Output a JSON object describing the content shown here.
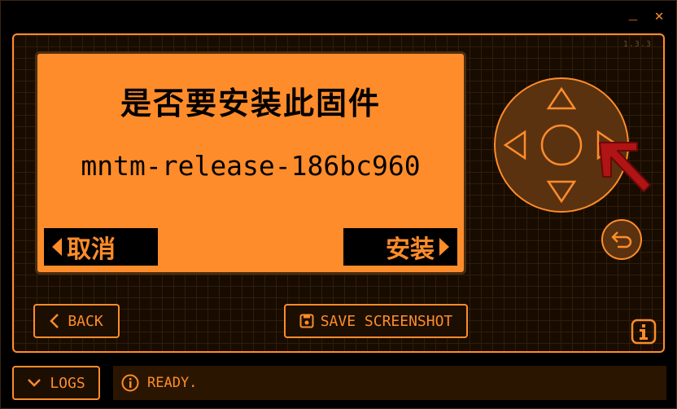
{
  "window": {
    "minimize_label": "_",
    "close_label": "✕"
  },
  "version": "1.3.3",
  "device_screen": {
    "title": "是否要安装此固件",
    "firmware_name": "mntm-release-186bc960",
    "left_button_label": "取消",
    "right_button_label": "安装"
  },
  "controls": {
    "back_label": "BACK",
    "screenshot_label": "SAVE SCREENSHOT",
    "logs_label": "LOGS"
  },
  "status": {
    "text": "READY."
  },
  "colors": {
    "accent": "#ff8c2a",
    "annotation_arrow": "#b01414"
  }
}
